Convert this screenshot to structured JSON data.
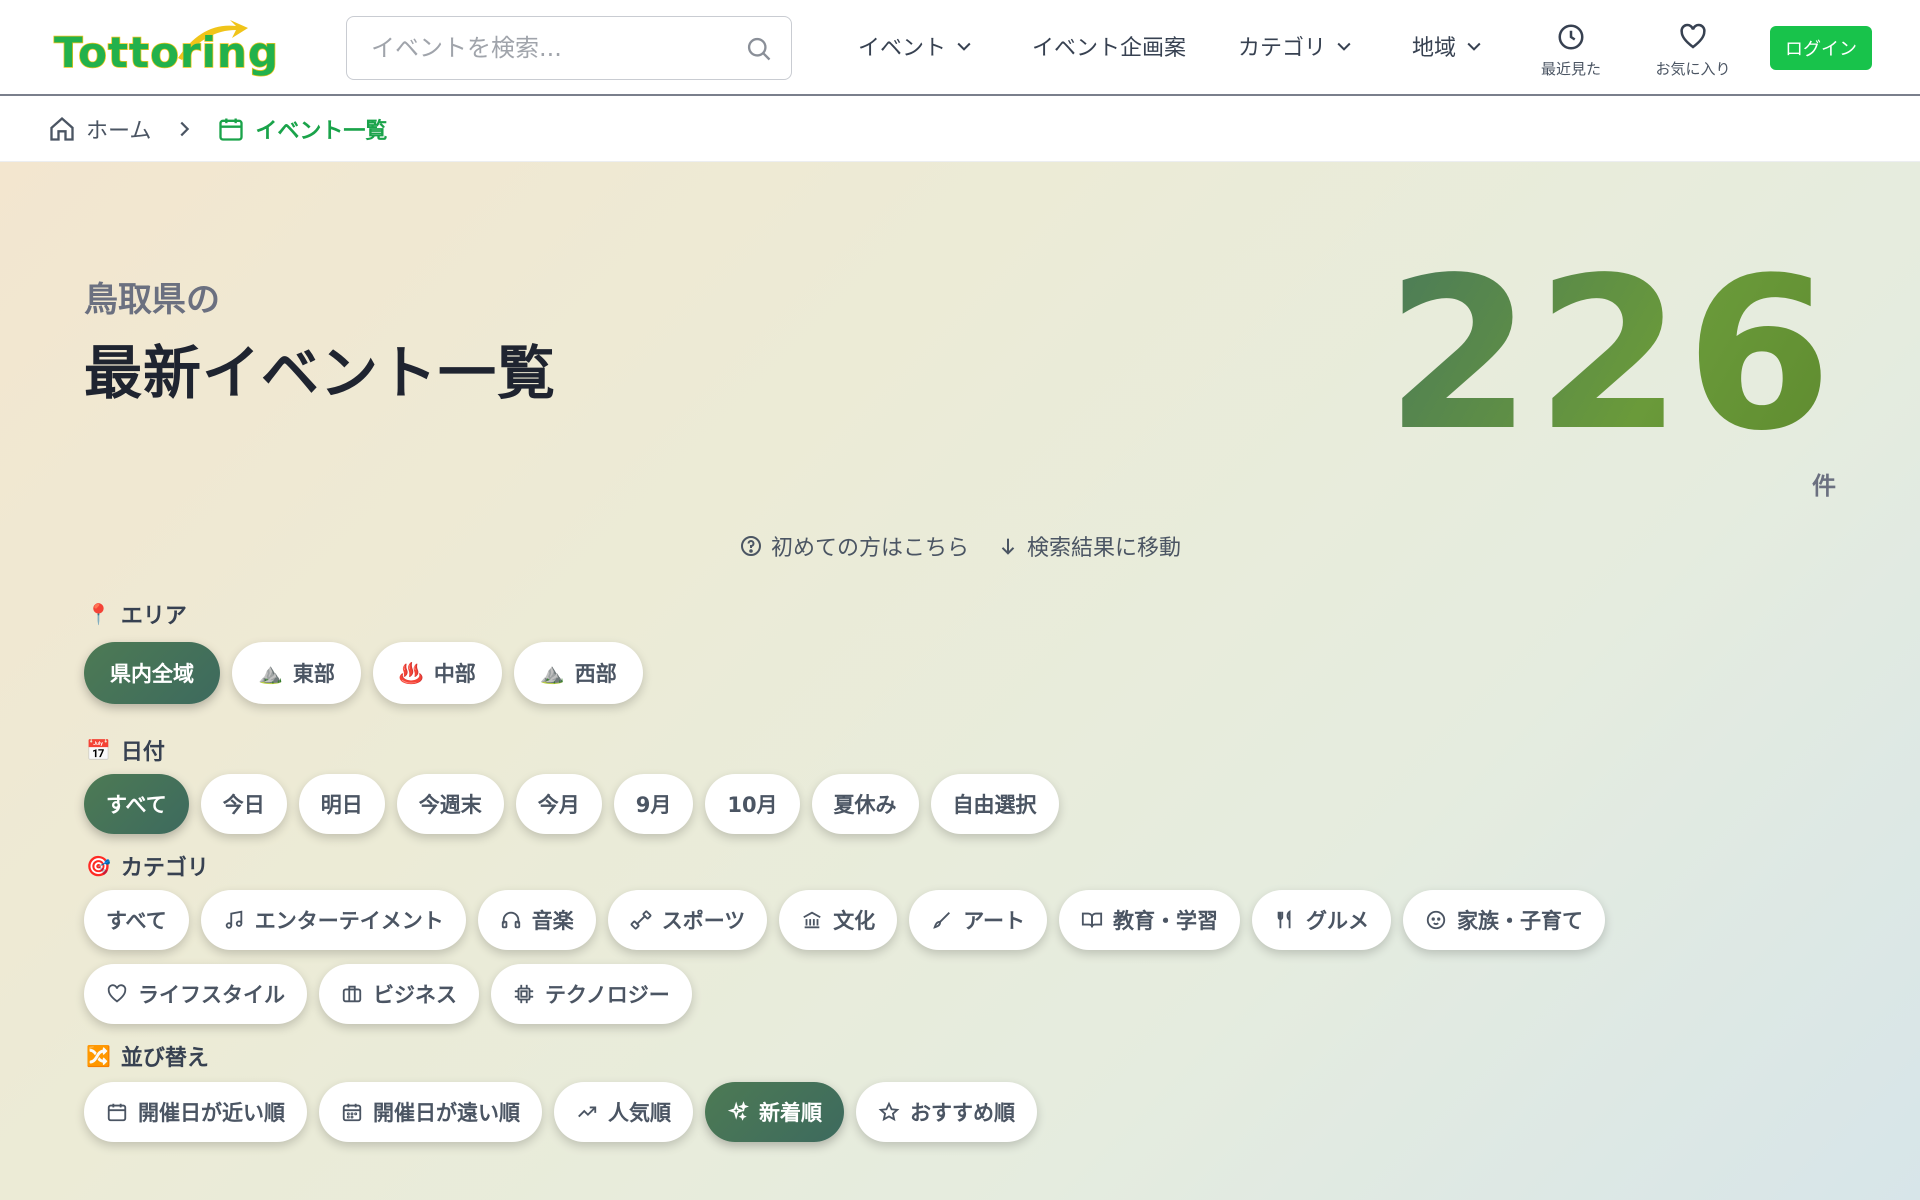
{
  "header": {
    "logo_text": "Tottoring",
    "search_placeholder": "イベントを検索...",
    "nav": [
      "イベント",
      "イベント企画案",
      "カテゴリ",
      "地域"
    ],
    "recent_label": "最近見た",
    "favorites_label": "お気に入り",
    "login_label": "ログイン"
  },
  "breadcrumb": {
    "home": "ホーム",
    "current": "イベント一覧"
  },
  "hero": {
    "subtitle": "鳥取県の",
    "title": "最新イベント一覧",
    "count": "226",
    "count_unit": "件",
    "help_first": "初めての方はこちら",
    "help_jump": "検索結果に移動"
  },
  "filters": {
    "area_label": "エリア",
    "area": [
      "県内全域",
      "東部",
      "中部",
      "西部"
    ],
    "date_label": "日付",
    "date": [
      "すべて",
      "今日",
      "明日",
      "今週末",
      "今月",
      "9月",
      "10月",
      "夏休み",
      "自由選択"
    ],
    "category_label": "カテゴリ",
    "category": [
      "すべて",
      "エンターテイメント",
      "音楽",
      "スポーツ",
      "文化",
      "アート",
      "教育・学習",
      "グルメ",
      "家族・子育て",
      "ライフスタイル",
      "ビジネス",
      "テクノロジー"
    ],
    "sort_label": "並び替え",
    "sort": [
      "開催日が近い順",
      "開催日が遠い順",
      "人気順",
      "新着順",
      "おすすめ順"
    ]
  },
  "colors": {
    "accent": "#18c34b",
    "active_chip": "#4d7a54"
  }
}
